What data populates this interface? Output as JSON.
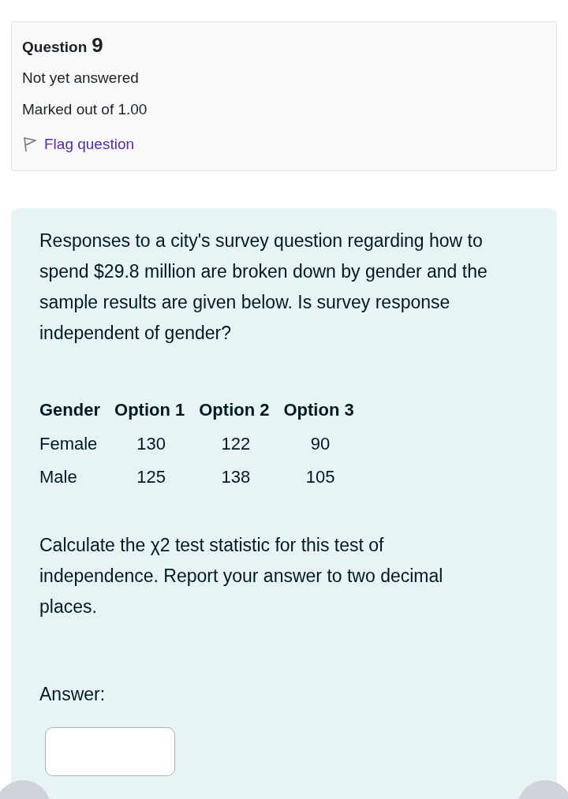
{
  "info": {
    "label": "Question",
    "number": "9",
    "status": "Not yet answered",
    "marks": "Marked out of 1.00",
    "flag": {
      "label": "Flag question",
      "flagged": false
    }
  },
  "question": {
    "text": "Responses to a city's survey question regarding how to spend $29.8 million are broken down by gender and the sample results are given below. Is survey response independent of gender?",
    "table": {
      "columns": [
        "Gender",
        "Option 1",
        "Option 2",
        "Option 3"
      ],
      "rows": [
        [
          "Female",
          "130",
          "122",
          "90"
        ],
        [
          "Male",
          "125",
          "138",
          "105"
        ]
      ]
    },
    "prompt": "Calculate the χ2 test statistic for this test of independence. Report your answer to two decimal places.",
    "answer_label": "Answer:"
  }
}
